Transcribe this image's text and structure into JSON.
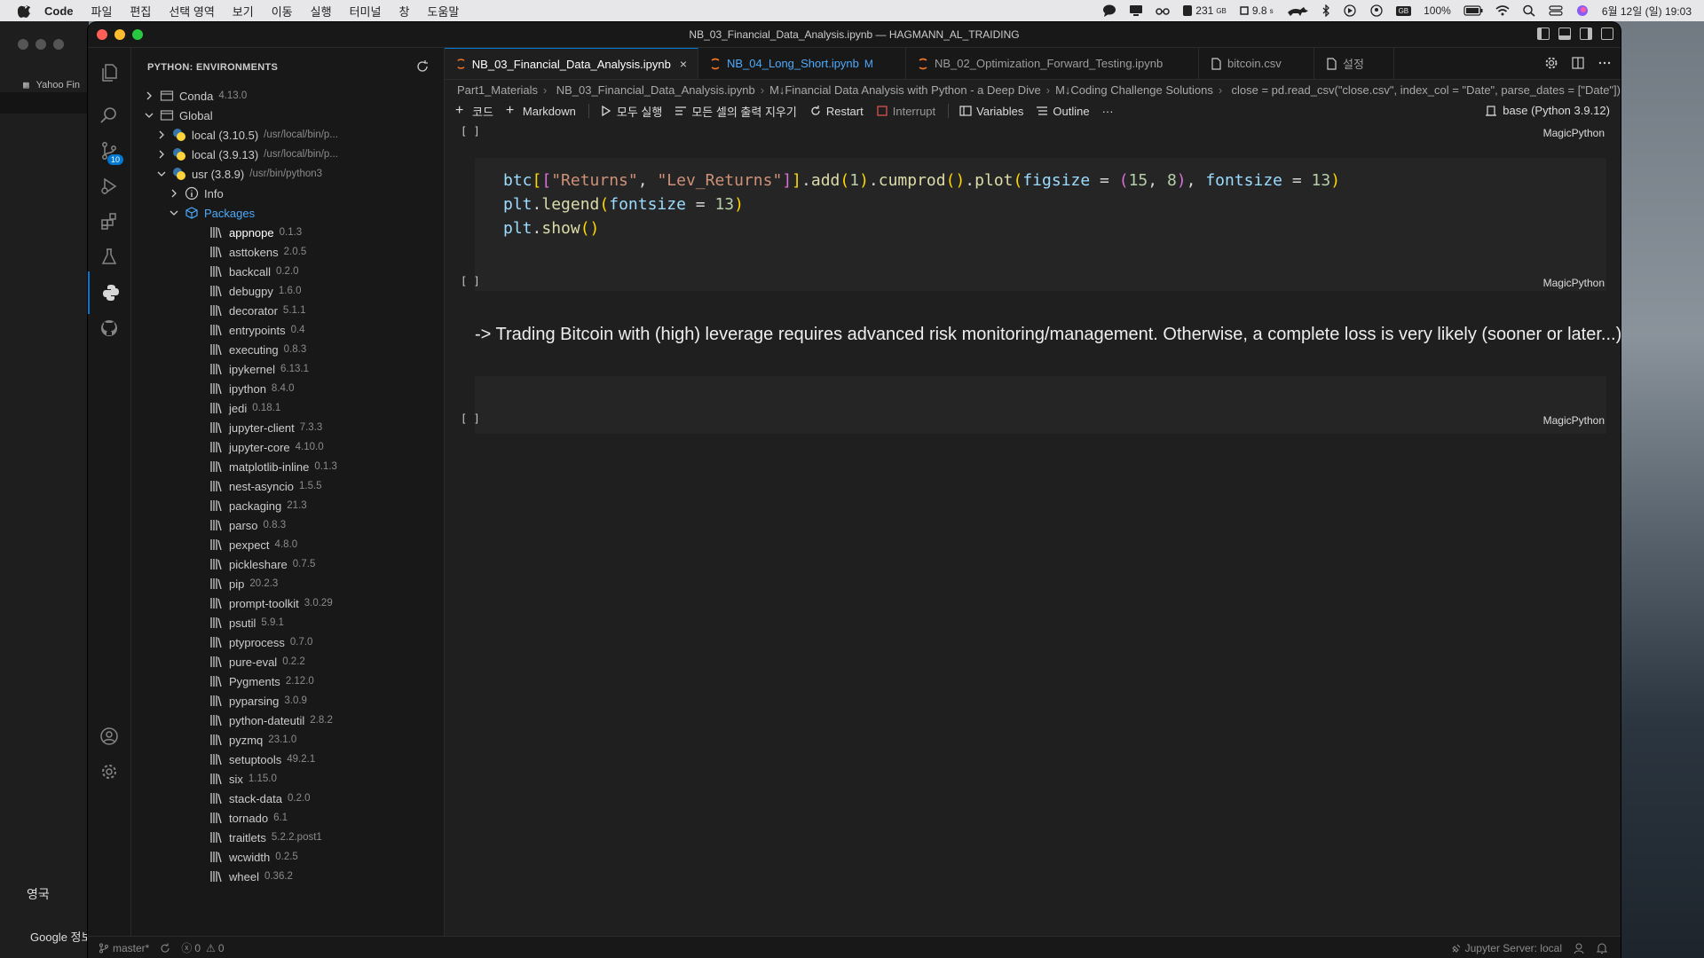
{
  "menubar": {
    "app": "Code",
    "items": [
      "파일",
      "편집",
      "선택 영역",
      "보기",
      "이동",
      "실행",
      "터미널",
      "창",
      "도움말"
    ],
    "storage": "231",
    "storage_unit": "GB",
    "cpu": "9.8",
    "cpu_unit": "s",
    "gb_badge": "GB",
    "battery": "100%",
    "datetime": "6월 12일 (일)  19:03"
  },
  "background_app": {
    "tab_label": "Yahoo Fin",
    "label1": "영국",
    "label2": "Google 정보"
  },
  "window": {
    "title": "NB_03_Financial_Data_Analysis.ipynb — HAGMANN_AL_TRAIDING"
  },
  "activity": {
    "source_control_badge": "10"
  },
  "sidebar": {
    "header": "PYTHON: ENVIRONMENTS",
    "tree": [
      {
        "label": "Conda",
        "version": "4.13.0",
        "level": 0,
        "chevron": "right",
        "icon": "folder"
      },
      {
        "label": "Global",
        "version": "",
        "level": 0,
        "chevron": "down",
        "icon": "folder"
      },
      {
        "label": "local (3.10.5)",
        "path": "/usr/local/bin/p...",
        "level": 1,
        "chevron": "right",
        "icon": "python"
      },
      {
        "label": "local (3.9.13)",
        "path": "/usr/local/bin/p...",
        "level": 1,
        "chevron": "right",
        "icon": "python"
      },
      {
        "label": "usr (3.8.9)",
        "path": "/usr/bin/python3",
        "level": 1,
        "chevron": "down",
        "icon": "python"
      },
      {
        "label": "Info",
        "version": "",
        "level": 2,
        "chevron": "right",
        "icon": "info"
      },
      {
        "label": "Packages",
        "version": "",
        "level": 2,
        "chevron": "down",
        "icon": "package"
      }
    ],
    "packages": [
      {
        "name": "appnope",
        "version": "0.1.3"
      },
      {
        "name": "asttokens",
        "version": "2.0.5"
      },
      {
        "name": "backcall",
        "version": "0.2.0"
      },
      {
        "name": "debugpy",
        "version": "1.6.0"
      },
      {
        "name": "decorator",
        "version": "5.1.1"
      },
      {
        "name": "entrypoints",
        "version": "0.4"
      },
      {
        "name": "executing",
        "version": "0.8.3"
      },
      {
        "name": "ipykernel",
        "version": "6.13.1"
      },
      {
        "name": "ipython",
        "version": "8.4.0"
      },
      {
        "name": "jedi",
        "version": "0.18.1"
      },
      {
        "name": "jupyter-client",
        "version": "7.3.3"
      },
      {
        "name": "jupyter-core",
        "version": "4.10.0"
      },
      {
        "name": "matplotlib-inline",
        "version": "0.1.3"
      },
      {
        "name": "nest-asyncio",
        "version": "1.5.5"
      },
      {
        "name": "packaging",
        "version": "21.3"
      },
      {
        "name": "parso",
        "version": "0.8.3"
      },
      {
        "name": "pexpect",
        "version": "4.8.0"
      },
      {
        "name": "pickleshare",
        "version": "0.7.5"
      },
      {
        "name": "pip",
        "version": "20.2.3"
      },
      {
        "name": "prompt-toolkit",
        "version": "3.0.29"
      },
      {
        "name": "psutil",
        "version": "5.9.1"
      },
      {
        "name": "ptyprocess",
        "version": "0.7.0"
      },
      {
        "name": "pure-eval",
        "version": "0.2.2"
      },
      {
        "name": "Pygments",
        "version": "2.12.0"
      },
      {
        "name": "pyparsing",
        "version": "3.0.9"
      },
      {
        "name": "python-dateutil",
        "version": "2.8.2"
      },
      {
        "name": "pyzmq",
        "version": "23.1.0"
      },
      {
        "name": "setuptools",
        "version": "49.2.1"
      },
      {
        "name": "six",
        "version": "1.15.0"
      },
      {
        "name": "stack-data",
        "version": "0.2.0"
      },
      {
        "name": "tornado",
        "version": "6.1"
      },
      {
        "name": "traitlets",
        "version": "5.2.2.post1"
      },
      {
        "name": "wcwidth",
        "version": "0.2.5"
      },
      {
        "name": "wheel",
        "version": "0.36.2"
      }
    ]
  },
  "tabs": [
    {
      "label": "NB_03_Financial_Data_Analysis.ipynb",
      "active": true,
      "icon": "notebook-icon",
      "close": "×"
    },
    {
      "label": "NB_04_Long_Short.ipynb",
      "active": false,
      "icon": "notebook-icon",
      "modified": "M"
    },
    {
      "label": "NB_02_Optimization_Forward_Testing.ipynb",
      "active": false,
      "icon": "notebook-icon"
    },
    {
      "label": "bitcoin.csv",
      "active": false,
      "icon": "file-icon"
    },
    {
      "label": "설정",
      "active": false,
      "icon": "file-icon"
    }
  ],
  "breadcrumb": [
    "Part1_Materials",
    "NB_03_Financial_Data_Analysis.ipynb",
    "M↓Financial Data Analysis with Python - a Deep Dive",
    "M↓Coding Challenge Solutions",
    "close = pd.read_csv(\"close.csv\", index_col = \"Date\", parse_dates = [\"Date\"])"
  ],
  "toolbar": {
    "code": "코드",
    "markdown": "Markdown",
    "run_all": "모두 실행",
    "clear_outputs": "모든 셀의 출력 지우기",
    "restart": "Restart",
    "interrupt": "Interrupt",
    "variables": "Variables",
    "outline": "Outline",
    "more": "···",
    "kernel": "base (Python 3.9.12)"
  },
  "cells": {
    "bracket": "[ ]",
    "language": "MagicPython",
    "markdown_text": "-> Trading Bitcoin with (high) leverage requires advanced risk monitoring/management. Otherwise, a complete loss is very likely (sooner or later...)."
  },
  "status": {
    "branch": "master*",
    "errors": "0",
    "warnings": "0",
    "jupyter": "Jupyter Server: local"
  },
  "colors": {
    "accent": "#0078d4",
    "editor_bg": "#1f1f1f",
    "sidebar_bg": "#181818"
  }
}
